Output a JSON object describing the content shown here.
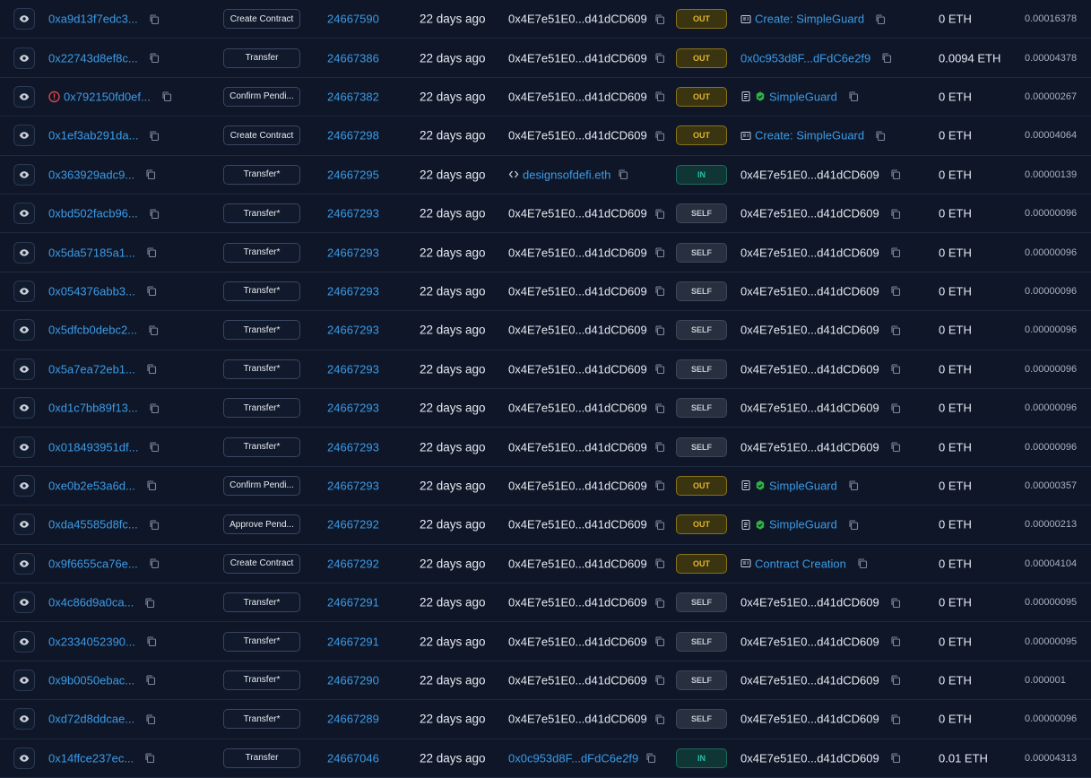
{
  "rows": [
    {
      "hash": "0xa9d13f7edc3...",
      "err": false,
      "method": "Create Contract",
      "block": "24667590",
      "age": "22 days ago",
      "from": "0x4E7e51E0...d41dCD609",
      "from_link": false,
      "from_icon": "",
      "dir": "OUT",
      "to": "Create: SimpleGuard",
      "to_link": true,
      "to_icon": "contract-creation-icon",
      "value": "0 ETH",
      "fee": "0.00016378"
    },
    {
      "hash": "0x22743d8ef8c...",
      "err": false,
      "method": "Transfer",
      "block": "24667386",
      "age": "22 days ago",
      "from": "0x4E7e51E0...d41dCD609",
      "from_link": false,
      "from_icon": "",
      "dir": "OUT",
      "to": "0x0c953d8F...dFdC6e2f9",
      "to_link": true,
      "to_icon": "",
      "value": "0.0094 ETH",
      "fee": "0.00004378"
    },
    {
      "hash": "0x792150fd0ef...",
      "err": true,
      "method": "Confirm Pendi...",
      "block": "24667382",
      "age": "22 days ago",
      "from": "0x4E7e51E0...d41dCD609",
      "from_link": false,
      "from_icon": "",
      "dir": "OUT",
      "to": "SimpleGuard",
      "to_link": true,
      "to_icon": "verified-contract-icon",
      "value": "0 ETH",
      "fee": "0.00000267"
    },
    {
      "hash": "0x1ef3ab291da...",
      "err": false,
      "method": "Create Contract",
      "block": "24667298",
      "age": "22 days ago",
      "from": "0x4E7e51E0...d41dCD609",
      "from_link": false,
      "from_icon": "",
      "dir": "OUT",
      "to": "Create: SimpleGuard",
      "to_link": true,
      "to_icon": "contract-creation-icon",
      "value": "0 ETH",
      "fee": "0.00004064"
    },
    {
      "hash": "0x363929adc9...",
      "err": false,
      "method": "Transfer*",
      "block": "24667295",
      "age": "22 days ago",
      "from": "designsofdefi.eth",
      "from_link": true,
      "from_icon": "code-icon",
      "dir": "IN",
      "to": "0x4E7e51E0...d41dCD609",
      "to_link": false,
      "to_icon": "",
      "value": "0 ETH",
      "fee": "0.00000139"
    },
    {
      "hash": "0xbd502facb96...",
      "err": false,
      "method": "Transfer*",
      "block": "24667293",
      "age": "22 days ago",
      "from": "0x4E7e51E0...d41dCD609",
      "from_link": false,
      "from_icon": "",
      "dir": "SELF",
      "to": "0x4E7e51E0...d41dCD609",
      "to_link": false,
      "to_icon": "",
      "value": "0 ETH",
      "fee": "0.00000096"
    },
    {
      "hash": "0x5da57185a1...",
      "err": false,
      "method": "Transfer*",
      "block": "24667293",
      "age": "22 days ago",
      "from": "0x4E7e51E0...d41dCD609",
      "from_link": false,
      "from_icon": "",
      "dir": "SELF",
      "to": "0x4E7e51E0...d41dCD609",
      "to_link": false,
      "to_icon": "",
      "value": "0 ETH",
      "fee": "0.00000096"
    },
    {
      "hash": "0x054376abb3...",
      "err": false,
      "method": "Transfer*",
      "block": "24667293",
      "age": "22 days ago",
      "from": "0x4E7e51E0...d41dCD609",
      "from_link": false,
      "from_icon": "",
      "dir": "SELF",
      "to": "0x4E7e51E0...d41dCD609",
      "to_link": false,
      "to_icon": "",
      "value": "0 ETH",
      "fee": "0.00000096"
    },
    {
      "hash": "0x5dfcb0debc2...",
      "err": false,
      "method": "Transfer*",
      "block": "24667293",
      "age": "22 days ago",
      "from": "0x4E7e51E0...d41dCD609",
      "from_link": false,
      "from_icon": "",
      "dir": "SELF",
      "to": "0x4E7e51E0...d41dCD609",
      "to_link": false,
      "to_icon": "",
      "value": "0 ETH",
      "fee": "0.00000096"
    },
    {
      "hash": "0x5a7ea72eb1...",
      "err": false,
      "method": "Transfer*",
      "block": "24667293",
      "age": "22 days ago",
      "from": "0x4E7e51E0...d41dCD609",
      "from_link": false,
      "from_icon": "",
      "dir": "SELF",
      "to": "0x4E7e51E0...d41dCD609",
      "to_link": false,
      "to_icon": "",
      "value": "0 ETH",
      "fee": "0.00000096"
    },
    {
      "hash": "0xd1c7bb89f13...",
      "err": false,
      "method": "Transfer*",
      "block": "24667293",
      "age": "22 days ago",
      "from": "0x4E7e51E0...d41dCD609",
      "from_link": false,
      "from_icon": "",
      "dir": "SELF",
      "to": "0x4E7e51E0...d41dCD609",
      "to_link": false,
      "to_icon": "",
      "value": "0 ETH",
      "fee": "0.00000096"
    },
    {
      "hash": "0x018493951df...",
      "err": false,
      "method": "Transfer*",
      "block": "24667293",
      "age": "22 days ago",
      "from": "0x4E7e51E0...d41dCD609",
      "from_link": false,
      "from_icon": "",
      "dir": "SELF",
      "to": "0x4E7e51E0...d41dCD609",
      "to_link": false,
      "to_icon": "",
      "value": "0 ETH",
      "fee": "0.00000096"
    },
    {
      "hash": "0xe0b2e53a6d...",
      "err": false,
      "method": "Confirm Pendi...",
      "block": "24667293",
      "age": "22 days ago",
      "from": "0x4E7e51E0...d41dCD609",
      "from_link": false,
      "from_icon": "",
      "dir": "OUT",
      "to": "SimpleGuard",
      "to_link": true,
      "to_icon": "verified-contract-icon",
      "value": "0 ETH",
      "fee": "0.00000357"
    },
    {
      "hash": "0xda45585d8fc...",
      "err": false,
      "method": "Approve Pend...",
      "block": "24667292",
      "age": "22 days ago",
      "from": "0x4E7e51E0...d41dCD609",
      "from_link": false,
      "from_icon": "",
      "dir": "OUT",
      "to": "SimpleGuard",
      "to_link": true,
      "to_icon": "verified-contract-icon",
      "value": "0 ETH",
      "fee": "0.00000213"
    },
    {
      "hash": "0x9f6655ca76e...",
      "err": false,
      "method": "Create Contract",
      "block": "24667292",
      "age": "22 days ago",
      "from": "0x4E7e51E0...d41dCD609",
      "from_link": false,
      "from_icon": "",
      "dir": "OUT",
      "to": "Contract Creation",
      "to_link": true,
      "to_icon": "contract-creation-icon",
      "value": "0 ETH",
      "fee": "0.00004104"
    },
    {
      "hash": "0x4c86d9a0ca...",
      "err": false,
      "method": "Transfer*",
      "block": "24667291",
      "age": "22 days ago",
      "from": "0x4E7e51E0...d41dCD609",
      "from_link": false,
      "from_icon": "",
      "dir": "SELF",
      "to": "0x4E7e51E0...d41dCD609",
      "to_link": false,
      "to_icon": "",
      "value": "0 ETH",
      "fee": "0.00000095"
    },
    {
      "hash": "0x2334052390...",
      "err": false,
      "method": "Transfer*",
      "block": "24667291",
      "age": "22 days ago",
      "from": "0x4E7e51E0...d41dCD609",
      "from_link": false,
      "from_icon": "",
      "dir": "SELF",
      "to": "0x4E7e51E0...d41dCD609",
      "to_link": false,
      "to_icon": "",
      "value": "0 ETH",
      "fee": "0.00000095"
    },
    {
      "hash": "0x9b0050ebac...",
      "err": false,
      "method": "Transfer*",
      "block": "24667290",
      "age": "22 days ago",
      "from": "0x4E7e51E0...d41dCD609",
      "from_link": false,
      "from_icon": "",
      "dir": "SELF",
      "to": "0x4E7e51E0...d41dCD609",
      "to_link": false,
      "to_icon": "",
      "value": "0 ETH",
      "fee": "0.000001"
    },
    {
      "hash": "0xd72d8ddcae...",
      "err": false,
      "method": "Transfer*",
      "block": "24667289",
      "age": "22 days ago",
      "from": "0x4E7e51E0...d41dCD609",
      "from_link": false,
      "from_icon": "",
      "dir": "SELF",
      "to": "0x4E7e51E0...d41dCD609",
      "to_link": false,
      "to_icon": "",
      "value": "0 ETH",
      "fee": "0.00000096"
    },
    {
      "hash": "0x14ffce237ec...",
      "err": false,
      "method": "Transfer",
      "block": "24667046",
      "age": "22 days ago",
      "from": "0x0c953d8F...dFdC6e2f9",
      "from_link": true,
      "from_icon": "",
      "dir": "IN",
      "to": "0x4E7e51E0...d41dCD609",
      "to_link": false,
      "to_icon": "",
      "value": "0.01 ETH",
      "fee": "0.00004313"
    }
  ],
  "colors": {
    "link": "#3c9be6",
    "out": "#e0b630",
    "in": "#27c2a6",
    "self": "#c3c8d2",
    "error": "#e5484d",
    "verified": "#2fb344"
  }
}
